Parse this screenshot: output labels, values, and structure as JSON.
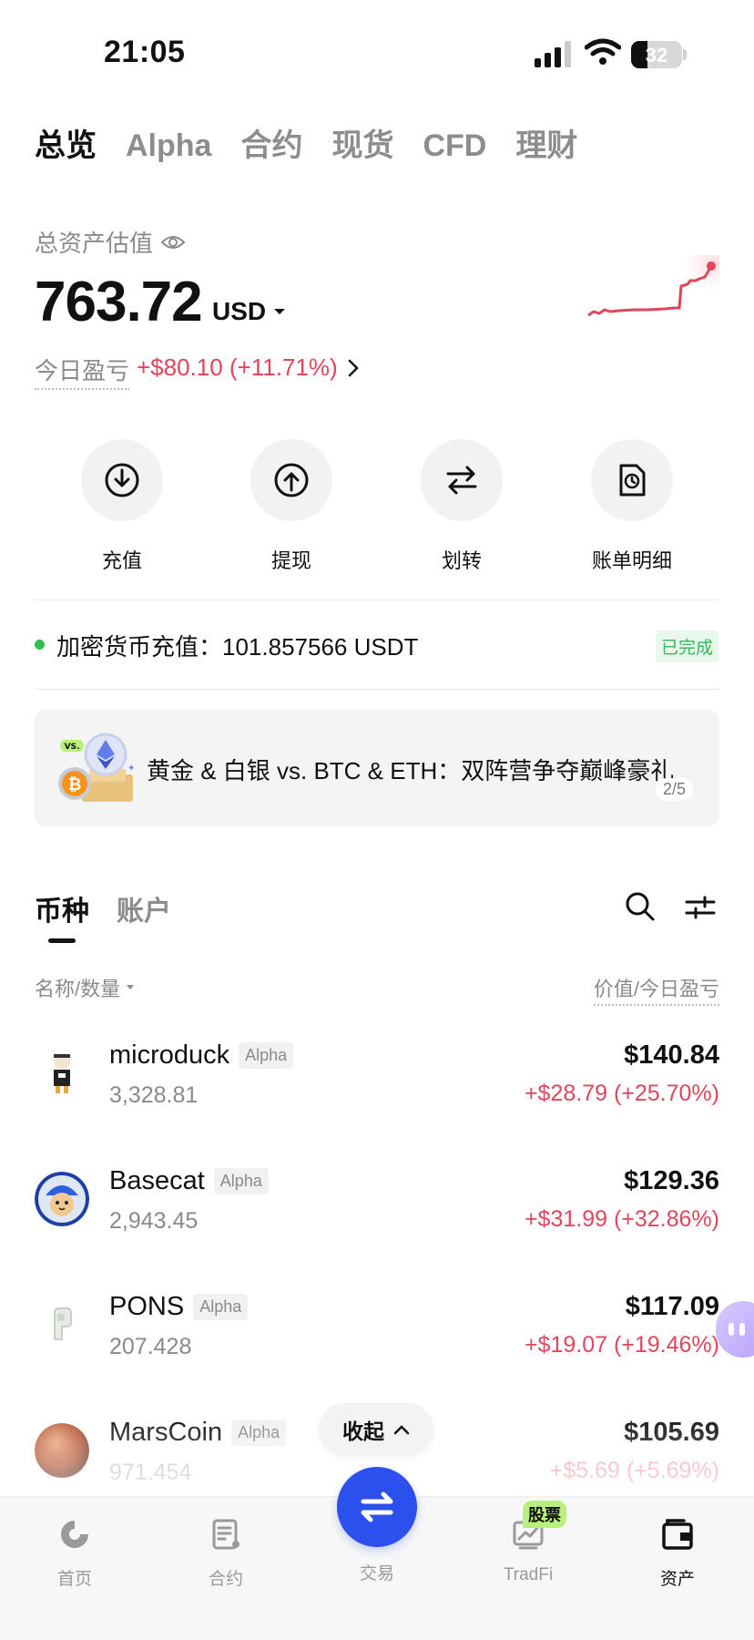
{
  "status": {
    "time": "21:05",
    "battery": "32"
  },
  "top_tabs": [
    "总览",
    "Alpha",
    "合约",
    "现货",
    "CFD",
    "理财"
  ],
  "overview": {
    "est_label": "总资产估值",
    "balance": "763.72",
    "currency": "USD",
    "pnl_label": "今日盈亏",
    "pnl_value": "+$80.10 (+11.71%)"
  },
  "actions": [
    {
      "label": "充值",
      "icon": "download-icon"
    },
    {
      "label": "提现",
      "icon": "upload-icon"
    },
    {
      "label": "划转",
      "icon": "transfer-icon"
    },
    {
      "label": "账单明细",
      "icon": "bill-icon"
    }
  ],
  "deposit": {
    "text": "加密货币充值：101.857566 USDT",
    "status": "已完成"
  },
  "banner": {
    "text": "黄金 & 白银 vs. BTC & ETH：双阵营争夺巅峰豪礼",
    "page": "2/5",
    "art_badge": "VS."
  },
  "section_tabs": [
    "币种",
    "账户"
  ],
  "columns": {
    "left": "名称/数量",
    "right": "价值/今日盈亏"
  },
  "assets": [
    {
      "name": "microduck",
      "tag": "Alpha",
      "qty": "3,328.81",
      "value": "$140.84",
      "change": "+$28.79 (+25.70%)"
    },
    {
      "name": "Basecat",
      "tag": "Alpha",
      "qty": "2,943.45",
      "value": "$129.36",
      "change": "+$31.99 (+32.86%)"
    },
    {
      "name": "PONS",
      "tag": "Alpha",
      "qty": "207.428",
      "value": "$117.09",
      "change": "+$19.07 (+19.46%)"
    },
    {
      "name": "MarsCoin",
      "tag": "Alpha",
      "qty": "971.454",
      "value": "$105.69",
      "change": "+$5.69 (+5.69%)"
    }
  ],
  "collapse_label": "收起",
  "bottom_nav": [
    {
      "label": "首页",
      "icon": "home-icon"
    },
    {
      "label": "合约",
      "icon": "contract-icon"
    },
    {
      "label": "交易",
      "icon": "trade-icon"
    },
    {
      "label": "TradFi",
      "icon": "tradfi-icon",
      "badge": "股票"
    },
    {
      "label": "资产",
      "icon": "wallet-icon"
    }
  ],
  "colors": {
    "accent": "#2b50ed",
    "profit": "#e0455c",
    "success": "#3bb55b"
  }
}
